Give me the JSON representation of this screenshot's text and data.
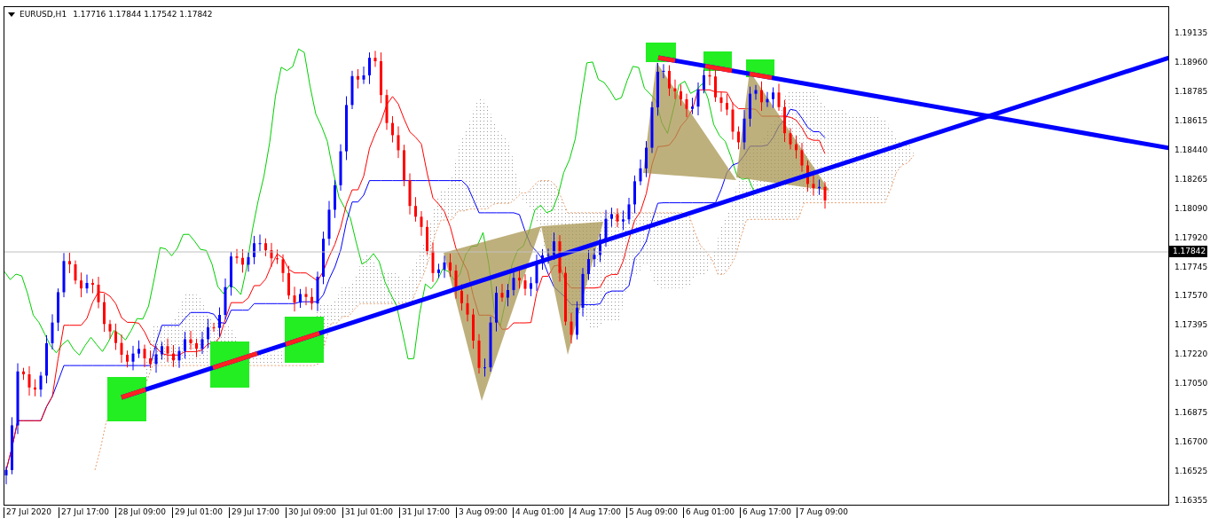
{
  "chart": {
    "symbol": "EURUSD,H1",
    "quote": "1.17716 1.17844 1.17542 1.17842",
    "price_axis": [
      "1.19135",
      "1.18960",
      "1.18785",
      "1.18615",
      "1.18440",
      "1.18265",
      "1.18090",
      "1.17920",
      "1.17745",
      "1.17570",
      "1.17395",
      "1.17220",
      "1.17050",
      "1.16875",
      "1.16700",
      "1.16525",
      "1.16355"
    ],
    "current_price": "1.17842",
    "time_axis": [
      "27 Jul 2020",
      "27 Jul 17:00",
      "28 Jul 09:00",
      "29 Jul 01:00",
      "29 Jul 17:00",
      "30 Jul 09:00",
      "31 Jul 01:00",
      "31 Jul 17:00",
      "3 Aug 09:00",
      "4 Aug 01:00",
      "4 Aug 17:00",
      "5 Aug 09:00",
      "6 Aug 01:00",
      "6 Aug 17:00",
      "7 Aug 09:00"
    ]
  }
}
